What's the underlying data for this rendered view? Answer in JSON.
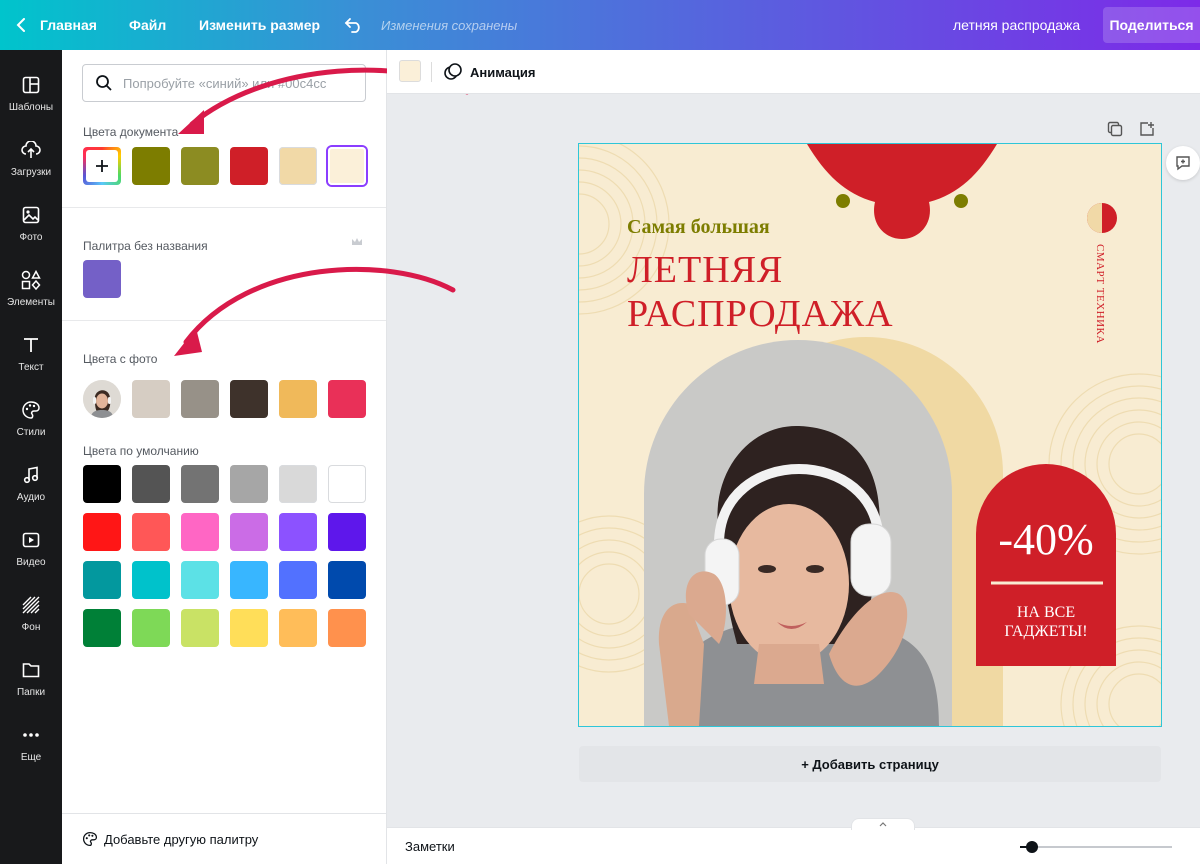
{
  "topbar": {
    "home_label": "Главная",
    "file_label": "Файл",
    "resize_label": "Изменить размер",
    "saved_status": "Изменения сохранены",
    "doc_title": "летняя распродажа",
    "share_label": "Поделиться"
  },
  "rail": {
    "items": [
      {
        "label": "Шаблоны",
        "icon": "templates-icon"
      },
      {
        "label": "Загрузки",
        "icon": "upload-icon"
      },
      {
        "label": "Фото",
        "icon": "photo-icon"
      },
      {
        "label": "Элементы",
        "icon": "elements-icon"
      },
      {
        "label": "Текст",
        "icon": "text-icon"
      },
      {
        "label": "Стили",
        "icon": "palette-icon"
      },
      {
        "label": "Аудио",
        "icon": "music-icon"
      },
      {
        "label": "Видео",
        "icon": "video-icon"
      },
      {
        "label": "Фон",
        "icon": "background-icon"
      },
      {
        "label": "Папки",
        "icon": "folder-icon"
      },
      {
        "label": "Еще",
        "icon": "more-icon"
      }
    ]
  },
  "panel": {
    "search_placeholder": "Попробуйте «синий» или #00c4cc",
    "doc_colors_title": "Цвета документа",
    "doc_colors": [
      "#7d7d00",
      "#8c8c22",
      "#cf1f28",
      "#f1d9a7",
      "#fbf0d9"
    ],
    "unnamed_palette_title": "Палитра без названия",
    "unnamed_palette": [
      "#7460c7"
    ],
    "photo_colors_title": "Цвета с фото",
    "photo_colors": [
      "#d6cdc3",
      "#979188",
      "#3e322b",
      "#f0b95a",
      "#e93058"
    ],
    "default_colors_title": "Цвета по умолчанию",
    "default_colors": [
      [
        "#000000",
        "#545454",
        "#737373",
        "#a6a6a6",
        "#d9d9d9",
        "#ffffff"
      ],
      [
        "#ff1616",
        "#ff5757",
        "#ff66c4",
        "#cb6ce6",
        "#8c52ff",
        "#5e17eb"
      ],
      [
        "#03989e",
        "#00c2cb",
        "#5ce1e6",
        "#38b6ff",
        "#5271ff",
        "#004aad"
      ],
      [
        "#008037",
        "#7ed957",
        "#c9e265",
        "#ffde59",
        "#ffbd59",
        "#ff914d"
      ]
    ],
    "add_palette_label": "Добавьте другую палитру"
  },
  "toolbar": {
    "animation_label": "Анимация"
  },
  "design": {
    "subtitle": "Самая большая",
    "title_line1": "ЛЕТНЯЯ",
    "title_line2": "РАСПРОДАЖА",
    "vertical_brand": "СМАРТ ТЕХНИКА",
    "discount": "-40%",
    "promo_line1": "НА ВСЕ",
    "promo_line2": "ГАДЖЕТЫ!",
    "accent_red": "#cf1f28",
    "accent_olive": "#7d7d00",
    "background": "#f8ecd2"
  },
  "canvas": {
    "add_page_label": "+ Добавить страницу"
  },
  "bottombar": {
    "notes_label": "Заметки",
    "zoom_level": 0.08
  }
}
